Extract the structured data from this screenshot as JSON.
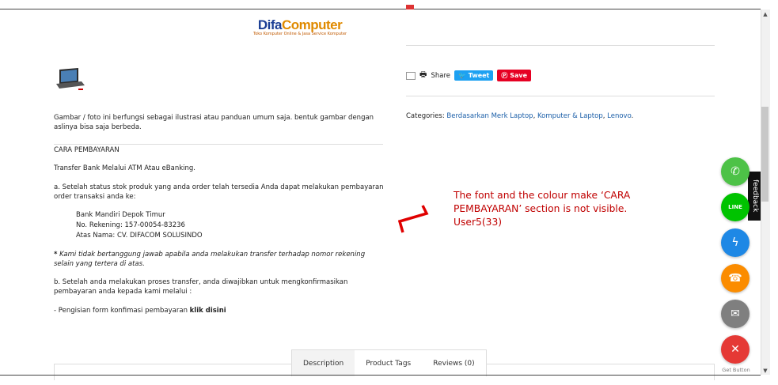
{
  "logo": {
    "part1": "Difa",
    "part2": "Computer",
    "tagline": "Toko Komputer Online & Jasa Service Komputer"
  },
  "disclaimer": "Gambar / foto ini berfungsi sebagai ilustrasi atau panduan umum saja. bentuk gambar dengan aslinya bisa saja berbeda.",
  "payment": {
    "heading": "CARA PEMBAYARAN",
    "method": "Transfer Bank Melalui ATM Atau eBanking.",
    "step_a": "a. Setelah status stok produk yang anda order telah tersedia Anda dapat melakukan pembayaran order transaksi anda ke:",
    "bank": "Bank Mandiri Depok Timur",
    "account_no": "No. Rekening: 157-00054-83236",
    "account_name": "Atas Nama: CV. DIFACOM SOLUSINDO",
    "note_star": "*",
    "note": " Kami tidak bertanggung jawab apabila anda melakukan transfer terhadap nomor rekening selain yang tertera di atas.",
    "step_b": "b. Setelah anda melakukan proses transfer, anda diwajibkan untuk mengkonfirmasikan pembayaran anda kepada kami melalui :",
    "confirm_prefix": "- Pengisian form konfimasi pembayaran ",
    "confirm_link": "klik disini"
  },
  "share": {
    "label": "Share",
    "tweet": "Tweet",
    "save": "Save"
  },
  "categories": {
    "label": "Categories: ",
    "items": [
      "Berdasarkan Merk Laptop",
      "Komputer & Laptop",
      "Lenovo"
    ],
    "sep1": ", ",
    "sep2": ", ",
    "end": "."
  },
  "annotation": "The font and the colour make ‘CARA PEMBAYARAN’ section is not visible. User5(33)",
  "feedback_label": "feedback",
  "get_button_label": "Get Button",
  "tabs": [
    "Description",
    "Product Tags",
    "Reviews (0)"
  ],
  "colors": {
    "whatsapp": "#4dc247",
    "line": "#00c300",
    "messenger": "#1e88e5",
    "call": "#fb8c00",
    "email": "#7f7f7f",
    "close": "#e53935",
    "annotation": "#c00000"
  },
  "icons": [
    "whatsapp-icon",
    "line-icon",
    "messenger-icon",
    "call-icon",
    "email-icon",
    "close-icon"
  ]
}
